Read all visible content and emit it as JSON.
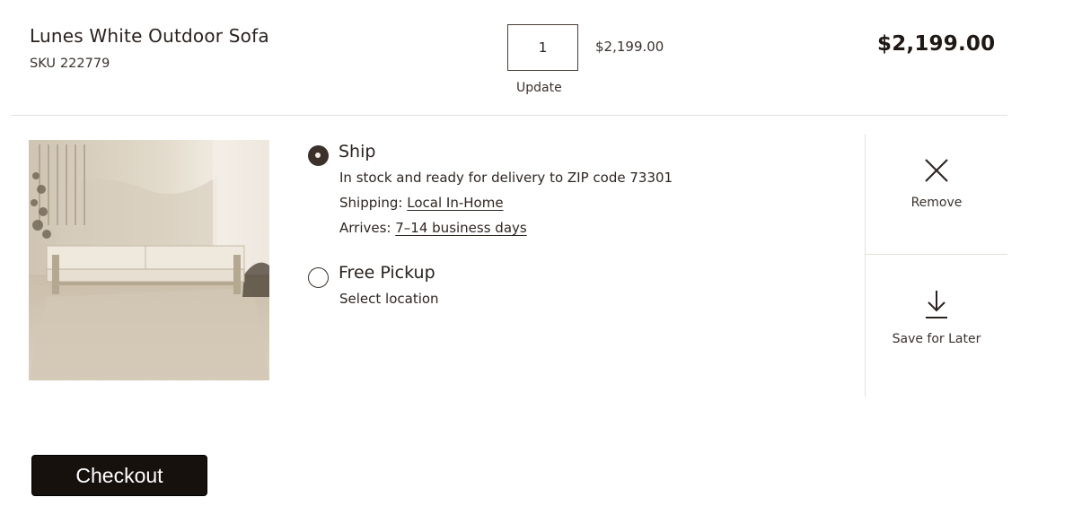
{
  "product": {
    "name": "Lunes White Outdoor Sofa",
    "sku_label": "SKU",
    "sku_value": "222779"
  },
  "quantity": {
    "value": "1",
    "update_label": "Update"
  },
  "pricing": {
    "unit_price": "$2,199.00",
    "line_total": "$2,199.00"
  },
  "fulfillment": {
    "ship": {
      "title": "Ship",
      "selected": true,
      "stock_text": "In stock and ready for delivery to ZIP code 73301",
      "shipping_prefix": "Shipping:",
      "shipping_method": "Local In-Home",
      "arrives_prefix": "Arrives:",
      "arrives_time": "7–14 business days"
    },
    "pickup": {
      "title": "Free Pickup",
      "selected": false,
      "select_location": "Select location"
    }
  },
  "actions": {
    "remove_label": "Remove",
    "remove_icon": "close-icon",
    "save_label": "Save for Later",
    "save_icon": "download-arrow-icon"
  },
  "checkout": {
    "label": "Checkout"
  },
  "colors": {
    "text": "#2a221e",
    "checkout_bg": "#17110e",
    "divider": "#e4e0dc"
  }
}
